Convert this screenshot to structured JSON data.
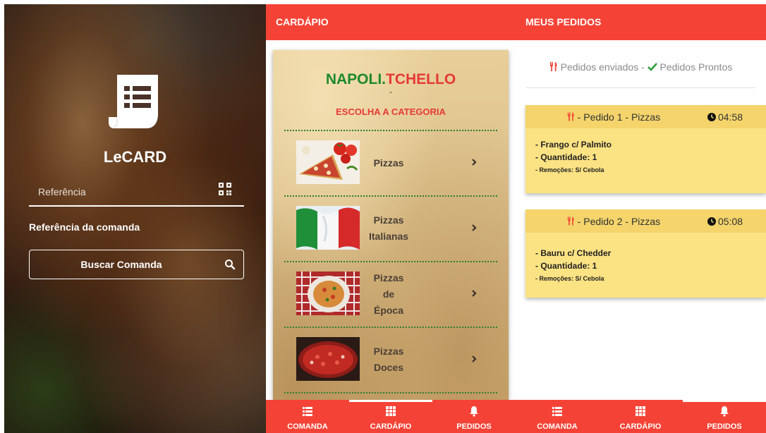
{
  "login": {
    "app_name": "LeCARD",
    "reference_placeholder": "Referência",
    "reference_label": "Referência da comanda",
    "search_button": "Buscar Comanda",
    "icons": {
      "logo": "receipt-list-icon",
      "qr": "qr-code-icon",
      "search": "search-icon"
    }
  },
  "cardapio": {
    "header": "CARDÁPIO",
    "brand_part1": "NAPOLI.",
    "brand_part2": "TCHELLO",
    "brand_sub": "-",
    "choose_category": "ESCOLHA A CATEGORIA",
    "categories": [
      {
        "label": "Pizzas"
      },
      {
        "label": "Pizzas Italianas"
      },
      {
        "label": "Pizzas de Época"
      },
      {
        "label": "Pizzas Doces"
      }
    ],
    "colors": {
      "brand_green": "#1d8a2a",
      "brand_red": "#e53935"
    }
  },
  "pedidos": {
    "header": "MEUS PEDIDOS",
    "legend_sent": "Pedidos enviados -",
    "legend_ready": "Pedidos Prontos",
    "orders": [
      {
        "title": "- Pedido 1 - Pizzas",
        "time": "04:58",
        "item": "- Frango c/ Palmito",
        "quantity": "- Quantidade: 1",
        "removals": "- Remoções: S/ Cebola"
      },
      {
        "title": "- Pedido 2 - Pizzas",
        "time": "05:08",
        "item": "- Bauru c/ Chedder",
        "quantity": "- Quantidade: 1",
        "removals": "- Remoções: S/ Cebola"
      }
    ]
  },
  "nav_left": {
    "items": [
      {
        "label": "COMANDA",
        "icon": "list-icon"
      },
      {
        "label": "CARDÁPIO",
        "icon": "grid-icon"
      },
      {
        "label": "PEDIDOS",
        "icon": "bell-icon"
      }
    ],
    "active": "CARDÁPIO"
  },
  "nav_right": {
    "items": [
      {
        "label": "COMANDA",
        "icon": "list-icon"
      },
      {
        "label": "CARDÁPIO",
        "icon": "grid-icon"
      },
      {
        "label": "PEDIDOS",
        "icon": "bell-icon"
      }
    ],
    "active": "PEDIDOS"
  },
  "colors": {
    "primary_red": "#f44336",
    "order_yellow": "#fbe283",
    "order_header_yellow": "#f4d46b",
    "ready_green": "#2e9d3a"
  }
}
